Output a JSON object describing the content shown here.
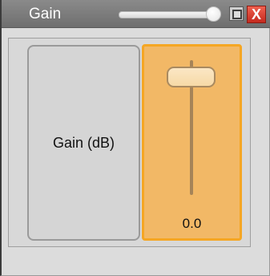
{
  "window": {
    "title": "Gain",
    "opacity_slider": {
      "level": 0.95
    },
    "maximize_icon": "square-icon",
    "close_label": "X"
  },
  "control": {
    "label": "Gain (dB)",
    "value": "0.0",
    "accent_color": "#f5a623"
  }
}
